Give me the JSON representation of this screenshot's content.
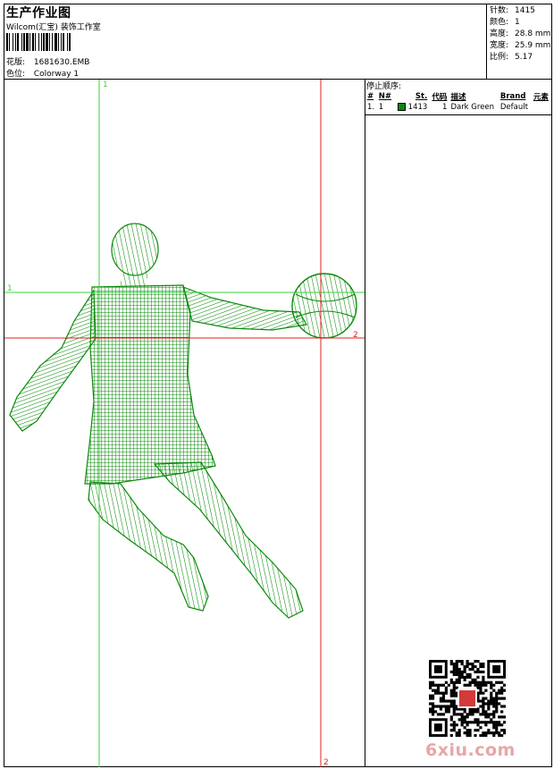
{
  "header": {
    "title": "生产作业图",
    "subtitle": "Wilcom(汇宝) 装饰工作室",
    "design_label": "花版:",
    "design_value": "1681630.EMB",
    "colorway_label": "色位:",
    "colorway_value": "Colorway 1"
  },
  "stats": [
    {
      "label": "针数:",
      "value": "1415"
    },
    {
      "label": "颜色:",
      "value": "1"
    },
    {
      "label": "高度:",
      "value": "28.8 mm"
    },
    {
      "label": "宽度:",
      "value": "25.9 mm"
    },
    {
      "label": "比例:",
      "value": "5.17"
    }
  ],
  "stop_sequence": {
    "title": "停止顺序:",
    "headers": [
      "#",
      "N#",
      "St.",
      "代码",
      "描述",
      "Brand",
      "元素"
    ],
    "rows": [
      {
        "index": "1.",
        "needle": "1",
        "swatch_color": "#0a8a0a",
        "stitches": "1413",
        "code": "1",
        "description": "Dark Green",
        "brand": "Default",
        "element": ""
      }
    ]
  },
  "design": {
    "thread_color": "#0a8a0a",
    "guide_green": "#39d339",
    "guide_red": "#e02020",
    "markers": {
      "v_green": "1",
      "h_green": "1",
      "v_red": "2",
      "h_red": "2"
    }
  },
  "watermark": {
    "text": "6xiu.com",
    "color": "#e8a6a6"
  }
}
